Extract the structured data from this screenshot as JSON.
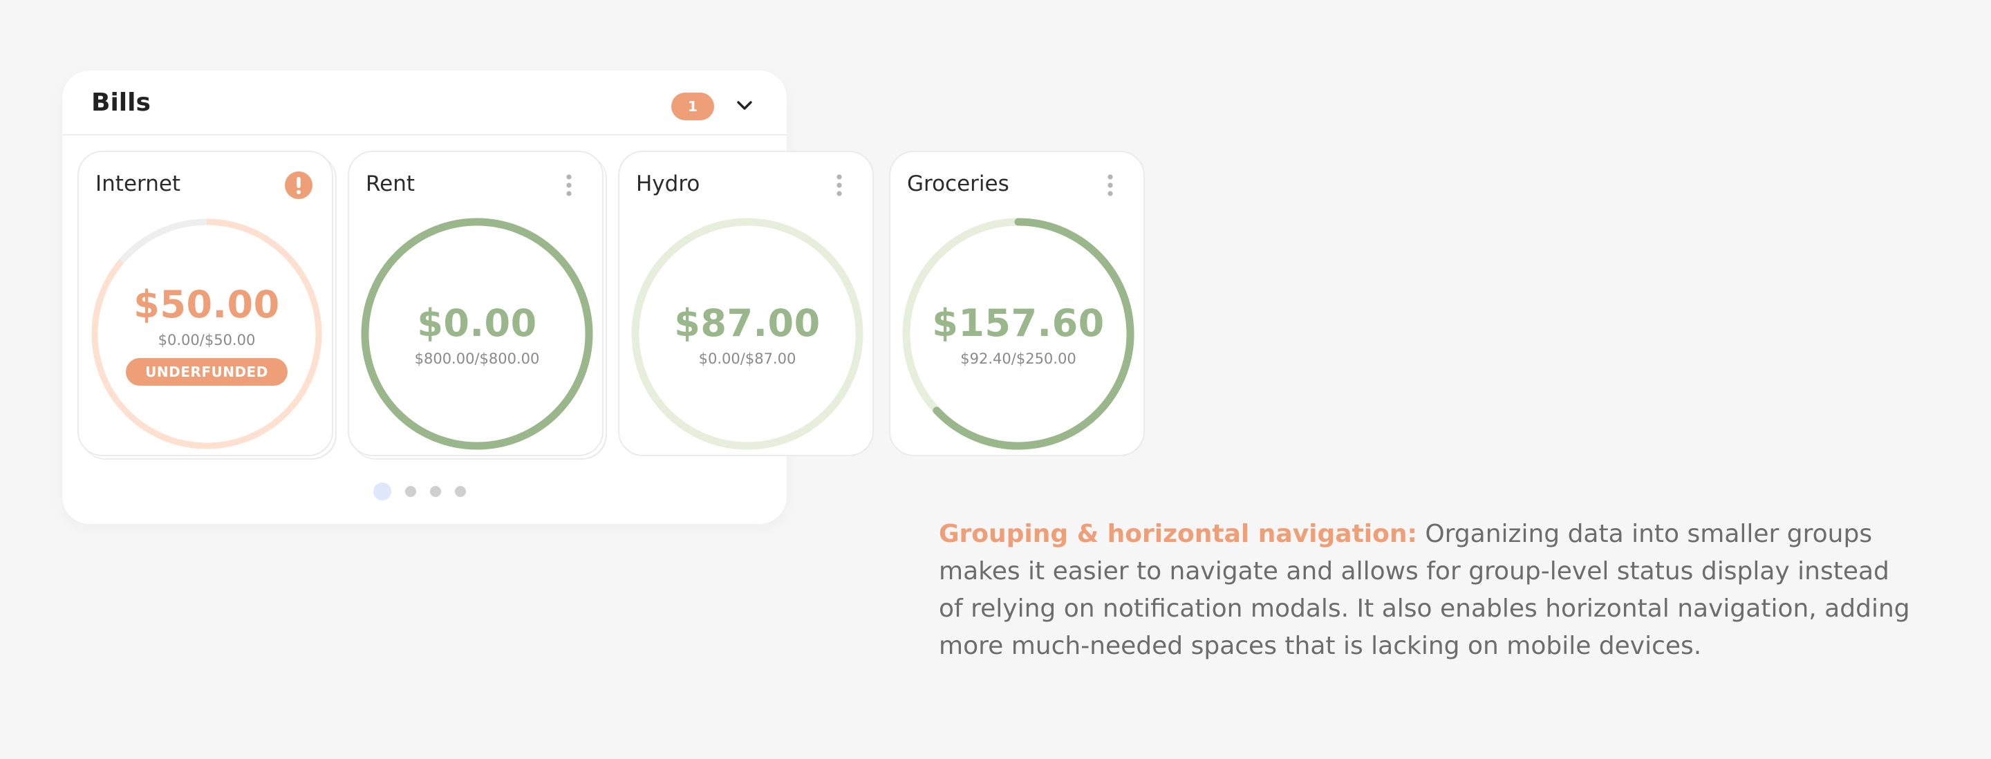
{
  "panel": {
    "title": "Bills",
    "badge_count": "1",
    "expand_icon": "chevron-down-icon"
  },
  "cards": [
    {
      "name": "Internet",
      "amount": "$50.00",
      "sub": "$0.00/$50.00",
      "status": "UNDERFUNDED",
      "funded_fraction": 0.0,
      "action_icon": "exclamation-icon"
    },
    {
      "name": "Rent",
      "amount": "$0.00",
      "sub": "$800.00/$800.00",
      "funded_fraction": 1.0,
      "action_icon": "more-vertical-icon"
    },
    {
      "name": "Hydro",
      "amount": "$87.00",
      "sub": "$0.00/$87.00",
      "funded_fraction": 0.0,
      "action_icon": "more-vertical-icon"
    },
    {
      "name": "Groceries",
      "amount": "$157.60",
      "sub": "$92.40/$250.00",
      "funded_fraction": 0.63,
      "action_icon": "more-vertical-icon"
    }
  ],
  "pagination": {
    "pages": 4,
    "active": 0
  },
  "caption": {
    "highlight": "Grouping & horizontal navigation:",
    "text": " Organizing data into smaller groups makes it easier to navigate and allows for group-level status display instead of relying on notification modals. It also enables horizontal navigation, adding more much-needed spaces that is lacking on mobile devices."
  },
  "colors": {
    "accent_orange": "#ef9f78",
    "light_orange": "#fde0cf",
    "green": "#9ab68b",
    "light_green": "#e7eedb",
    "track_gray": "#eeeeee",
    "dot_active": "#dfe7fb"
  }
}
